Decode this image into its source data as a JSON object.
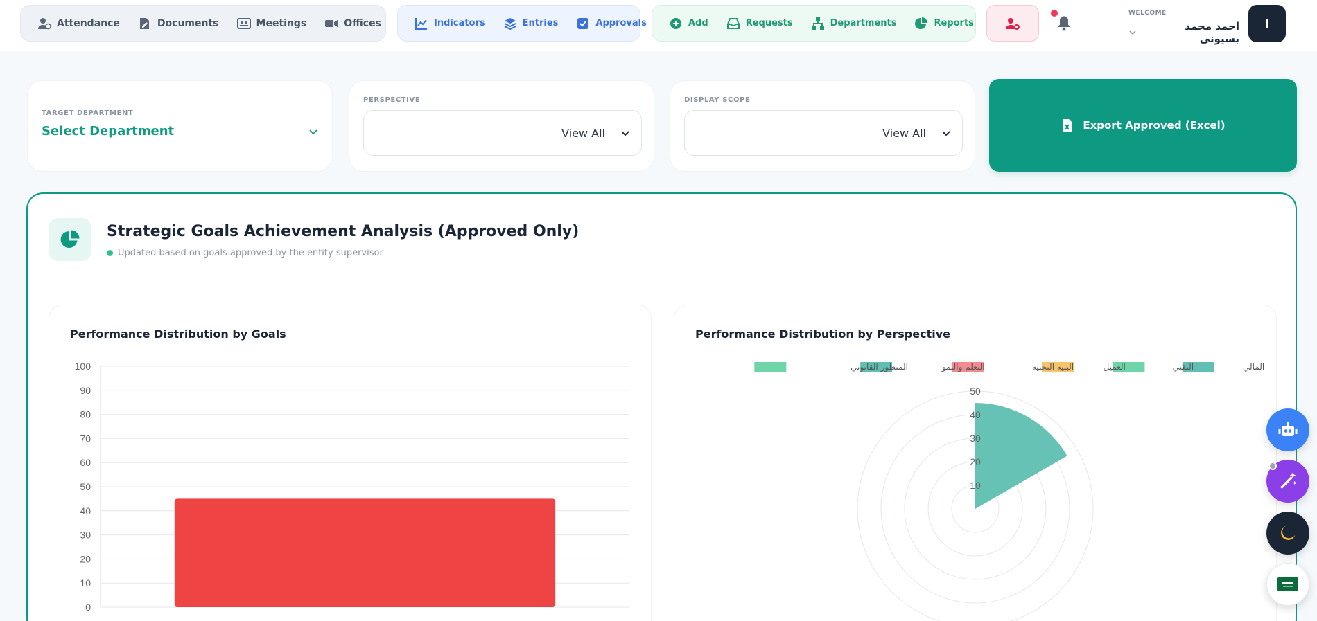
{
  "nav": {
    "group1": [
      {
        "label": "Attendance",
        "icon": "user-clock-icon"
      },
      {
        "label": "Documents",
        "icon": "file-signature-icon"
      },
      {
        "label": "Meetings",
        "icon": "meetings-icon"
      },
      {
        "label": "Offices",
        "icon": "video-icon"
      }
    ],
    "group2": [
      {
        "label": "Indicators",
        "icon": "line-chart-icon"
      },
      {
        "label": "Entries",
        "icon": "layers-icon"
      },
      {
        "label": "Approvals",
        "icon": "check-square-icon"
      }
    ],
    "group3": [
      {
        "label": "Add",
        "icon": "plus-circle-icon"
      },
      {
        "label": "Requests",
        "icon": "inbox-icon"
      },
      {
        "label": "Departments",
        "icon": "sitemap-icon"
      },
      {
        "label": "Reports",
        "icon": "pie-chart-icon"
      }
    ]
  },
  "user": {
    "welcome_label": "WELCOME",
    "name": "احمد محمد بسيونى",
    "avatar_initial": "I"
  },
  "filters": {
    "department": {
      "label": "TARGET DEPARTMENT",
      "value": "Select Department"
    },
    "perspective": {
      "label": "PERSPECTIVE",
      "value": "View All"
    },
    "scope": {
      "label": "DISPLAY SCOPE",
      "value": "View All"
    }
  },
  "export": {
    "label": "Export Approved (Excel)"
  },
  "panel": {
    "title": "Strategic Goals Achievement Analysis (Approved Only)",
    "subtitle": "Updated based on goals approved by the entity supervisor"
  },
  "colors": {
    "primary": "#0e9a82",
    "bar": "#ef4444",
    "polar_fill": "#5fbfb2"
  },
  "chart_data": [
    {
      "type": "bar",
      "title": "Performance Distribution by Goals",
      "categories": [
        ""
      ],
      "values": [
        45
      ],
      "ylim": [
        0,
        100
      ],
      "yticks": [
        0,
        10,
        20,
        30,
        40,
        50,
        60,
        70,
        80,
        90,
        100
      ],
      "grid": true
    },
    {
      "type": "polarArea",
      "title": "Performance Distribution by Perspective",
      "legend": [
        {
          "name": "المالي",
          "color": "#5fbfb2"
        },
        {
          "name": "التقني",
          "color": "#6fd4a7"
        },
        {
          "name": "العميل",
          "color": "#f7c46c"
        },
        {
          "name": "البنية التحتية",
          "color": "#f28b8f"
        },
        {
          "name": "التعلم والنمو",
          "color": "#5fbfb2"
        },
        {
          "name": "المنظور القانوني",
          "color": "#6fd4a7"
        }
      ],
      "values": [
        45,
        0,
        0,
        0,
        0,
        0
      ],
      "rlim": [
        0,
        50
      ],
      "rticks": [
        10,
        20,
        30,
        40,
        50
      ],
      "legend_position": "top"
    }
  ]
}
